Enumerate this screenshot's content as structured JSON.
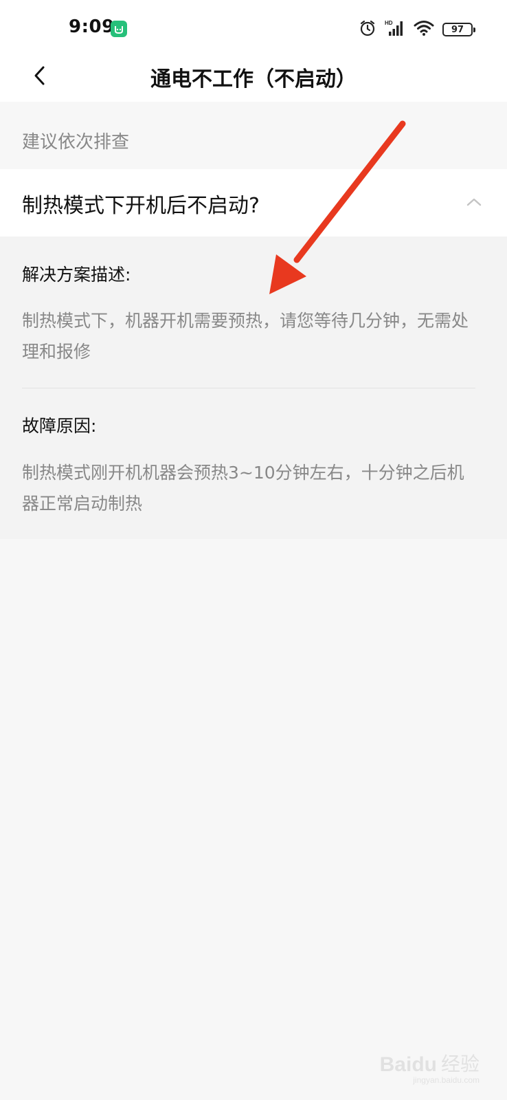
{
  "status_bar": {
    "time": "9:09",
    "battery": "97",
    "icons": [
      "app-notification-icon",
      "alarm-icon",
      "hd-signal-icon",
      "wifi-icon",
      "battery-icon"
    ]
  },
  "header": {
    "title": "通电不工作（不启动）"
  },
  "section": {
    "label": "建议依次排查"
  },
  "question": {
    "text": "制热模式下开机后不启动?",
    "expanded": true
  },
  "answer": {
    "solution_heading": "解决方案描述:",
    "solution_text": "制热模式下，机器开机需要预热，请您等待几分钟，无需处理和报修",
    "cause_heading": "故障原因:",
    "cause_text": "制热模式刚开机机器会预热3~10分钟左右，十分钟之后机器正常启动制热"
  },
  "annotation": {
    "arrow_color": "#e8391f"
  },
  "watermark": {
    "logo": "Baidu",
    "cn": "经验",
    "domain": "jingyan.baidu.com"
  },
  "colors": {
    "accent_green": "#26c07a",
    "page_bg": "#f7f7f7"
  }
}
